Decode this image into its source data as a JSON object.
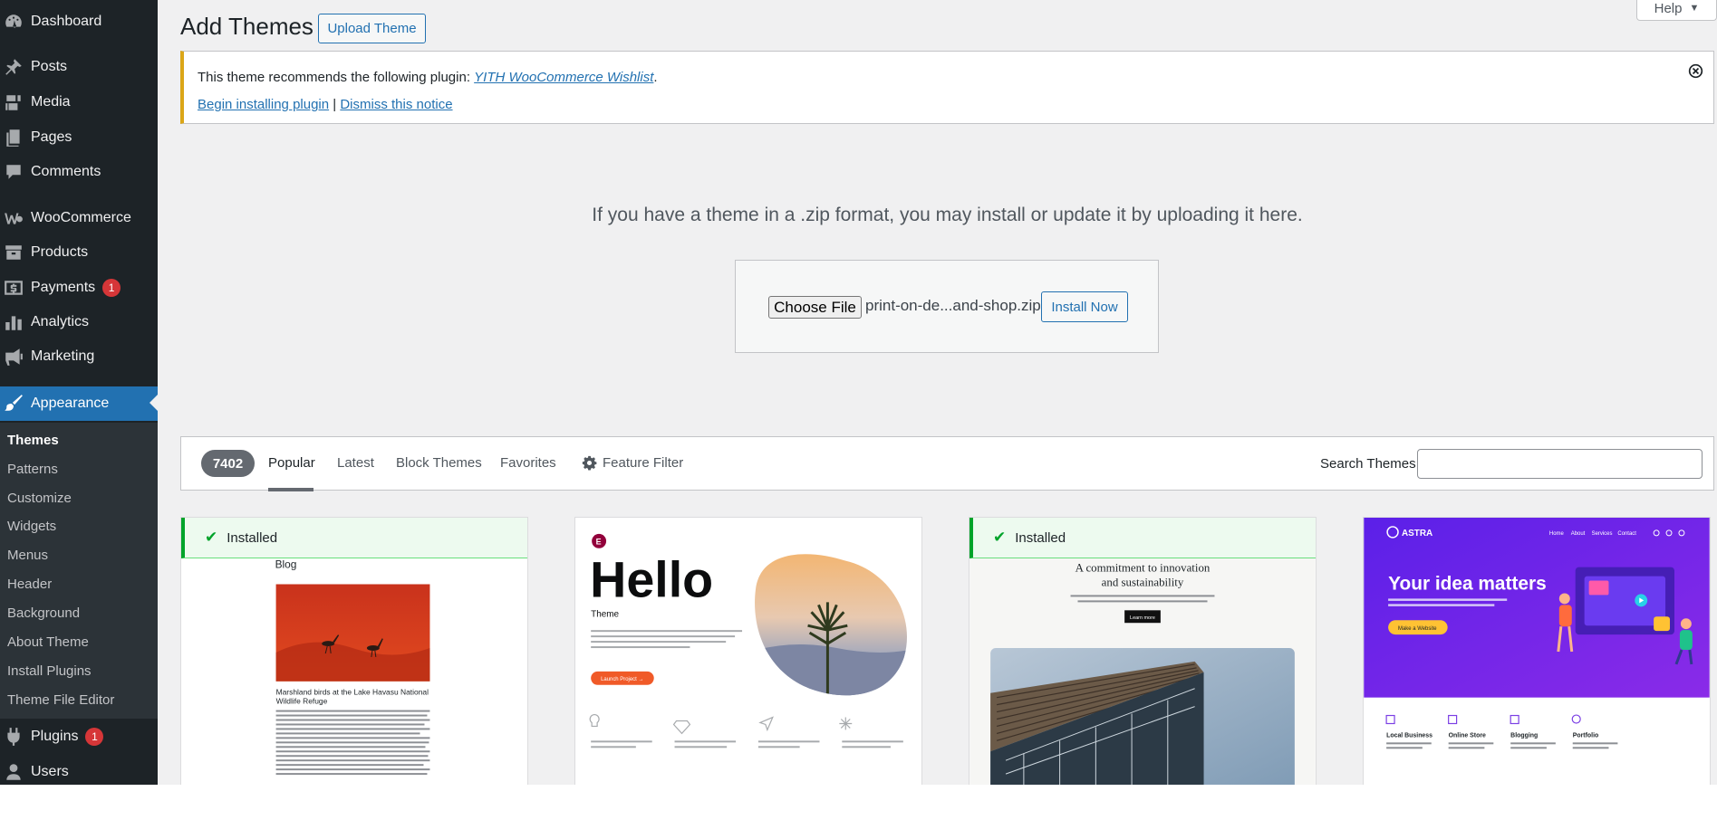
{
  "sidebar": {
    "items": [
      {
        "label": "Dashboard",
        "icon": "dashboard-icon"
      },
      {
        "label": "Posts",
        "icon": "pin-icon"
      },
      {
        "label": "Media",
        "icon": "media-icon"
      },
      {
        "label": "Pages",
        "icon": "pages-icon"
      },
      {
        "label": "Comments",
        "icon": "comment-icon"
      },
      {
        "label": "WooCommerce",
        "icon": "woocommerce-icon"
      },
      {
        "label": "Products",
        "icon": "archive-icon"
      },
      {
        "label": "Payments",
        "icon": "payments-icon",
        "badge": "1"
      },
      {
        "label": "Analytics",
        "icon": "bar-chart-icon"
      },
      {
        "label": "Marketing",
        "icon": "megaphone-icon"
      },
      {
        "label": "Appearance",
        "icon": "paintbrush-icon"
      },
      {
        "label": "Plugins",
        "icon": "plug-icon",
        "badge": "1"
      },
      {
        "label": "Users",
        "icon": "user-icon"
      }
    ],
    "submenu": [
      "Themes",
      "Patterns",
      "Customize",
      "Widgets",
      "Menus",
      "Header",
      "Background",
      "About Theme",
      "Install Plugins",
      "Theme File Editor"
    ]
  },
  "header": {
    "title": "Add Themes",
    "upload_label": "Upload Theme",
    "help_label": "Help"
  },
  "notice": {
    "text": "This theme recommends the following plugin: ",
    "plugin_name": "YITH WooCommerce Wishlist",
    "period": ".",
    "begin_label": "Begin installing plugin",
    "separator": " | ",
    "dismiss_label": "Dismiss this notice"
  },
  "upload": {
    "help_text": "If you have a theme in a .zip format, you may install or update it by uploading it here.",
    "choose_label": "Choose File",
    "file_name": "print-on-de...and-shop.zip",
    "install_label": "Install Now"
  },
  "filter": {
    "count": "7402",
    "tabs": [
      "Popular",
      "Latest",
      "Block Themes",
      "Favorites"
    ],
    "feature_filter": "Feature Filter",
    "search_label": "Search Themes",
    "search_value": ""
  },
  "themes": {
    "installed_label": "Installed",
    "card1": {
      "heading": "Blog",
      "caption": "Marshland birds at the Lake Havasu National Wildlife Refuge"
    },
    "card2": {
      "logo": "E",
      "title": "Hello",
      "subtitle": "Theme",
      "button": "Launch Project →"
    },
    "card3": {
      "heading_line1": "A commitment to innovation",
      "heading_line2": "and sustainability",
      "button": "Learn more"
    },
    "card4": {
      "brand": "ASTRA",
      "nav": [
        "Home",
        "About",
        "Services",
        "Contact"
      ],
      "headline": "Your idea matters",
      "button": "Make a Website",
      "features": [
        "Local Business",
        "Online Store",
        "Blogging",
        "Portfolio"
      ]
    }
  },
  "colors": {
    "sidebar_bg": "#1d2327",
    "accent": "#2271b1",
    "installed_green": "#00a32a",
    "notice_warning": "#dba617",
    "badge_red": "#d63638"
  }
}
